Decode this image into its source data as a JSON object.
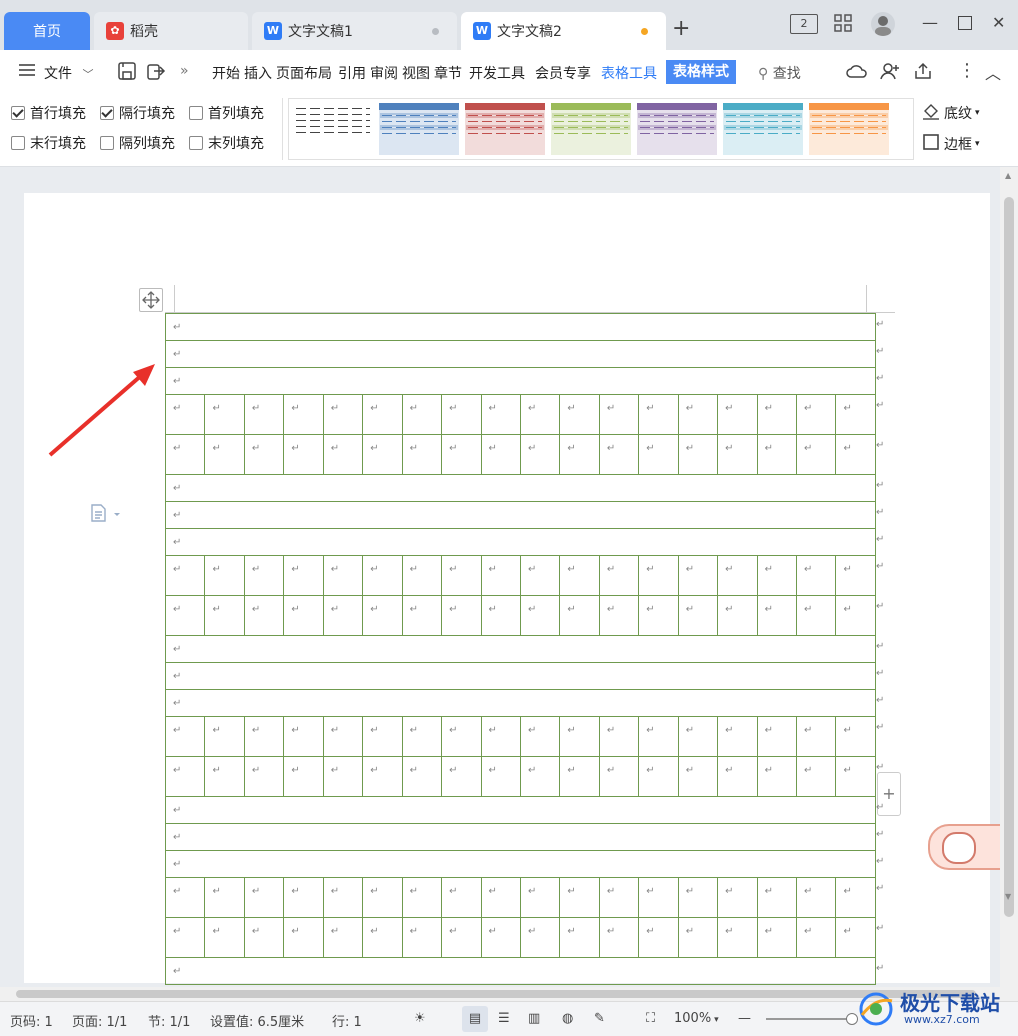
{
  "tabs": [
    {
      "label": "首页",
      "active": false,
      "type": "home"
    },
    {
      "label": "稻壳",
      "active": false,
      "type": "daoke"
    },
    {
      "label": "文字文稿1",
      "active": false,
      "type": "doc"
    },
    {
      "label": "文字文稿2",
      "active": true,
      "type": "doc",
      "unsaved": true
    }
  ],
  "titlebar": {
    "new_tab": "+",
    "multi_window": "2",
    "minimize": "—",
    "maximize": "☐",
    "close": "✕"
  },
  "menu": {
    "file": "文件",
    "items": [
      "开始",
      "插入",
      "页面布局",
      "引用",
      "审阅",
      "视图",
      "章节",
      "开发工具",
      "会员专享"
    ],
    "table_tools": "表格工具",
    "table_style": "表格样式",
    "search": "查找"
  },
  "ribbon": {
    "checkboxes": [
      {
        "label": "首行填充",
        "checked": true
      },
      {
        "label": "隔行填充",
        "checked": true
      },
      {
        "label": "首列填充",
        "checked": false
      },
      {
        "label": "末行填充",
        "checked": false
      },
      {
        "label": "隔列填充",
        "checked": false
      },
      {
        "label": "末列填充",
        "checked": false
      }
    ],
    "style_colors": [
      "#666666",
      "#4f81bd",
      "#c0504d",
      "#9bbb59",
      "#8064a2",
      "#4bacc6",
      "#f79646"
    ],
    "shading": "底纹",
    "border": "边框"
  },
  "document": {
    "para_mark": "↵",
    "column_count": 18
  },
  "statusbar": {
    "page_num": "页码: 1",
    "pages": "页面: 1/1",
    "section": "节: 1/1",
    "setting": "设置值: 6.5厘米",
    "row": "行: 1",
    "zoom": "100%"
  },
  "watermark": {
    "text": "极光下载站",
    "sub": "www.xz7.com"
  },
  "colors": {
    "accent": "#2f7cf6",
    "table_border": "#6f9a4e",
    "arrow": "#e8302a"
  }
}
